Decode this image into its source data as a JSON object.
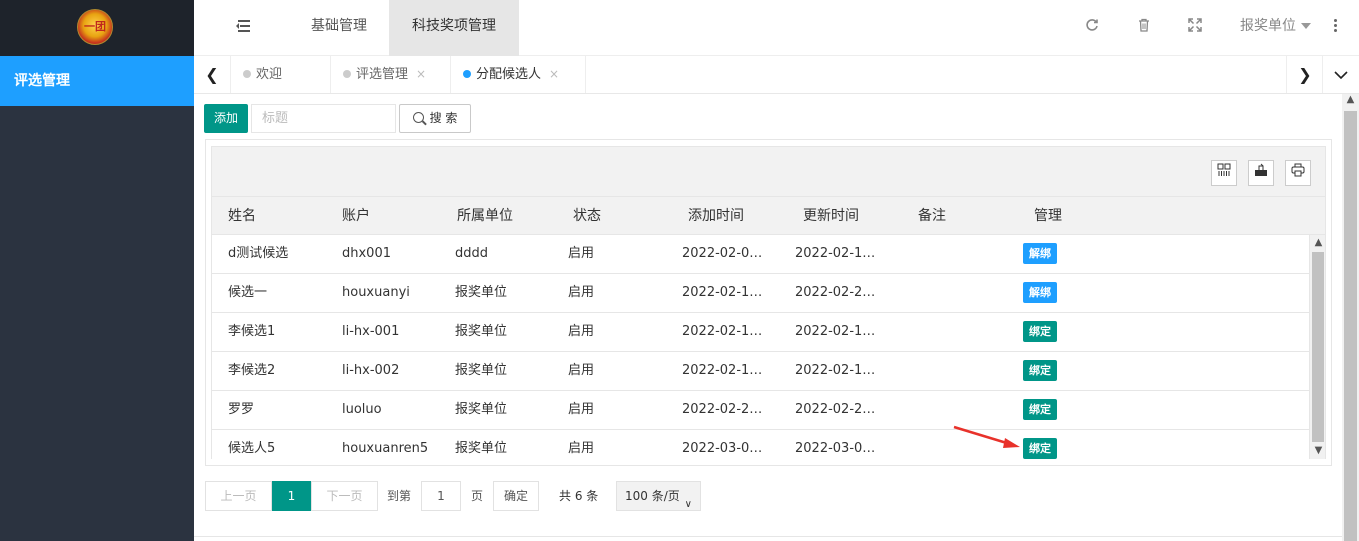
{
  "sidebar": {
    "logo_text": "一团",
    "menu_active": "评选管理"
  },
  "header": {
    "nav1": "基础管理",
    "nav2": "科技奖项管理",
    "user": "报奖单位",
    "icons": [
      "refresh-icon",
      "trash-icon",
      "fullscreen-icon",
      "more-icon"
    ]
  },
  "tabs": [
    {
      "label": "欢迎",
      "closable": false
    },
    {
      "label": "评选管理",
      "closable": true,
      "close": "×"
    },
    {
      "label": "分配候选人",
      "closable": true,
      "close": "×",
      "active": true
    }
  ],
  "toolbar": {
    "add_label": "添加",
    "search_placeholder": "标题",
    "search_label": "搜 索"
  },
  "table": {
    "headers": [
      "姓名",
      "账户",
      "所属单位",
      "状态",
      "添加时间",
      "更新时间",
      "备注",
      "管理"
    ],
    "rows": [
      {
        "name": "d测试候选",
        "account": "dhx001",
        "unit": "dddd",
        "status": "启用",
        "added": "2022-02-0…",
        "updated": "2022-02-1…",
        "note": "",
        "action": "解绑",
        "action_color": "#1e9fff"
      },
      {
        "name": "候选一",
        "account": "houxuanyi",
        "unit": "报奖单位",
        "status": "启用",
        "added": "2022-02-1…",
        "updated": "2022-02-2…",
        "note": "",
        "action": "解绑",
        "action_color": "#1e9fff"
      },
      {
        "name": "李候选1",
        "account": "li-hx-001",
        "unit": "报奖单位",
        "status": "启用",
        "added": "2022-02-1…",
        "updated": "2022-02-1…",
        "note": "",
        "action": "绑定",
        "action_color": "#009688"
      },
      {
        "name": "李候选2",
        "account": "li-hx-002",
        "unit": "报奖单位",
        "status": "启用",
        "added": "2022-02-1…",
        "updated": "2022-02-1…",
        "note": "",
        "action": "绑定",
        "action_color": "#009688"
      },
      {
        "name": "罗罗",
        "account": "luoluo",
        "unit": "报奖单位",
        "status": "启用",
        "added": "2022-02-2…",
        "updated": "2022-02-2…",
        "note": "",
        "action": "绑定",
        "action_color": "#009688"
      },
      {
        "name": "候选人5",
        "account": "houxuanren5",
        "unit": "报奖单位",
        "status": "启用",
        "added": "2022-03-0…",
        "updated": "2022-03-0…",
        "note": "",
        "action": "绑定",
        "action_color": "#009688"
      }
    ]
  },
  "pagination": {
    "prev": "上一页",
    "current": "1",
    "next": "下一页",
    "goto_label": "到第",
    "goto_value": "1",
    "page_unit": "页",
    "confirm": "确定",
    "total": "共 6 条",
    "page_size": "100 条/页"
  }
}
